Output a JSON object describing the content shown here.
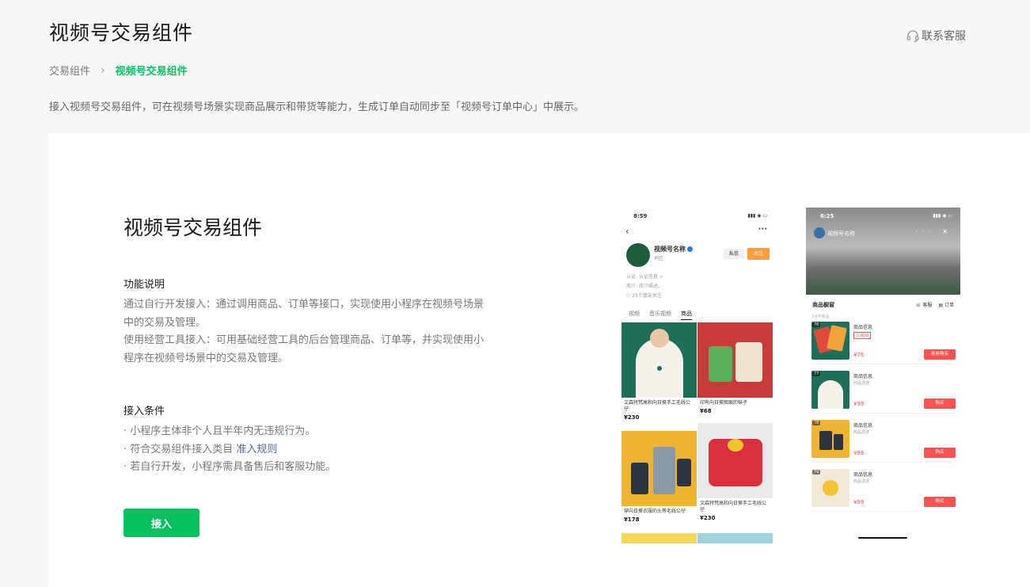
{
  "header": {
    "title": "视频号交易组件",
    "support_label": "联系客服",
    "breadcrumb": [
      "交易组件",
      "视频号交易组件"
    ],
    "description": "接入视频号交易组件，可在视频号场景实现商品展示和带货等能力，生成订单自动同步至「视频号订单中心」中展示。"
  },
  "card": {
    "title": "视频号交易组件",
    "features_heading": "功能说明",
    "features_lines": [
      "通过自行开发接入：通过调用商品、订单等接口，实现使用小程序在视频号场景",
      "中的交易及管理。",
      "使用经营工具接入：可用基础经营工具的后台管理商品、订单等，并实现使用小",
      "程序在视频号场景中的交易及管理。"
    ],
    "conditions_heading": "接入条件",
    "conditions": [
      "· 小程序主体非个人且半年内无违规行为。",
      "· 符合交易组件接入类目",
      "· 若自行开发，小程序需具备售后和客服功能。"
    ],
    "rules_link": "准入规则",
    "action_label": "接入"
  },
  "phone_profile": {
    "time": "8:59",
    "name": "视频号名称",
    "region": "地区",
    "message_btn": "私信",
    "follow_btn": "关注",
    "verify": "认证: 认证信息 >",
    "intro": "简介: 简介描述。",
    "friends": "25个朋友关注",
    "tabs": [
      "视频",
      "音乐视频",
      "商品"
    ],
    "products": [
      {
        "title": "文森特梵高和向日葵手工毛线公仔",
        "price": "¥230"
      },
      {
        "title": "印有向日葵图案的袜子",
        "price": "¥68"
      },
      {
        "title": "穿向日葵衣服的头等毛线公仔",
        "price": "¥178"
      },
      {
        "title": "文森特梵高和向日葵手工毛线公仔",
        "price": "¥230"
      }
    ]
  },
  "phone_live": {
    "time": "6:25",
    "name": "视频号名称",
    "sheet_title": "商品橱窗",
    "service": "客服",
    "order": "订单",
    "count": "50件商品",
    "items": [
      {
        "num": "76",
        "title": "商品信息",
        "sub": "",
        "coupon": "立减30",
        "price": "¥76",
        "btn": "用券购买"
      },
      {
        "num": "77",
        "title": "商品信息",
        "sub": "商品详述",
        "coupon": "",
        "price": "¥99",
        "btn": "购买"
      },
      {
        "num": "78",
        "title": "商品信息",
        "sub": "商品详述",
        "coupon": "",
        "price": "¥99",
        "btn": "购买"
      },
      {
        "num": "79",
        "title": "商品信息",
        "sub": "商品详述",
        "coupon": "",
        "price": "¥99",
        "btn": "购买"
      }
    ]
  }
}
